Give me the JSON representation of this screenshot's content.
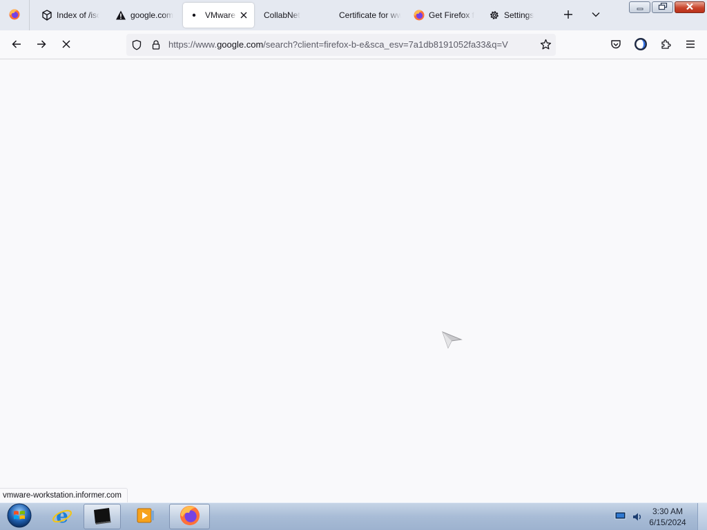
{
  "browser": {
    "tabs": [
      {
        "label": "",
        "icon": "firefox-icon",
        "pinned": true
      },
      {
        "label": "Index of /iso",
        "icon": "folder-network-icon"
      },
      {
        "label": "google.com",
        "icon": "warning-icon"
      },
      {
        "label": "VMware Workstation",
        "icon": "loading-dot-icon",
        "active": true
      },
      {
        "label": "CollabNet",
        "icon": ""
      },
      {
        "label": "Certificate for www",
        "icon": ""
      },
      {
        "label": "Get Firefox for",
        "icon": "firefox-icon"
      },
      {
        "label": "Settings",
        "icon": "gear-icon"
      }
    ],
    "url": {
      "scheme": "https://www.",
      "host": "google.com",
      "path": "/search?client=firefox-b-e&sca_esv=7a1db8191052fa33&q=V"
    },
    "status_text": "vmware-workstation.informer.com"
  },
  "taskbar": {
    "items": [
      {
        "name": "start-button",
        "icon": "windows-orb-icon"
      },
      {
        "name": "internet-explorer",
        "icon": "internet-explorer-icon"
      },
      {
        "name": "command-prompt",
        "icon": "terminal-icon"
      },
      {
        "name": "media-player",
        "icon": "media-player-icon"
      },
      {
        "name": "firefox",
        "icon": "firefox-icon"
      }
    ],
    "clock": {
      "time": "3:30 AM",
      "date": "6/15/2024"
    }
  },
  "colors": {
    "tabstrip_bg": "#e5e9f1",
    "toolbar_bg": "#f9f9fb",
    "urlbar_bg": "#f0f0f4",
    "close_button": "#c8452c",
    "taskbar": "#a8bcd6"
  }
}
